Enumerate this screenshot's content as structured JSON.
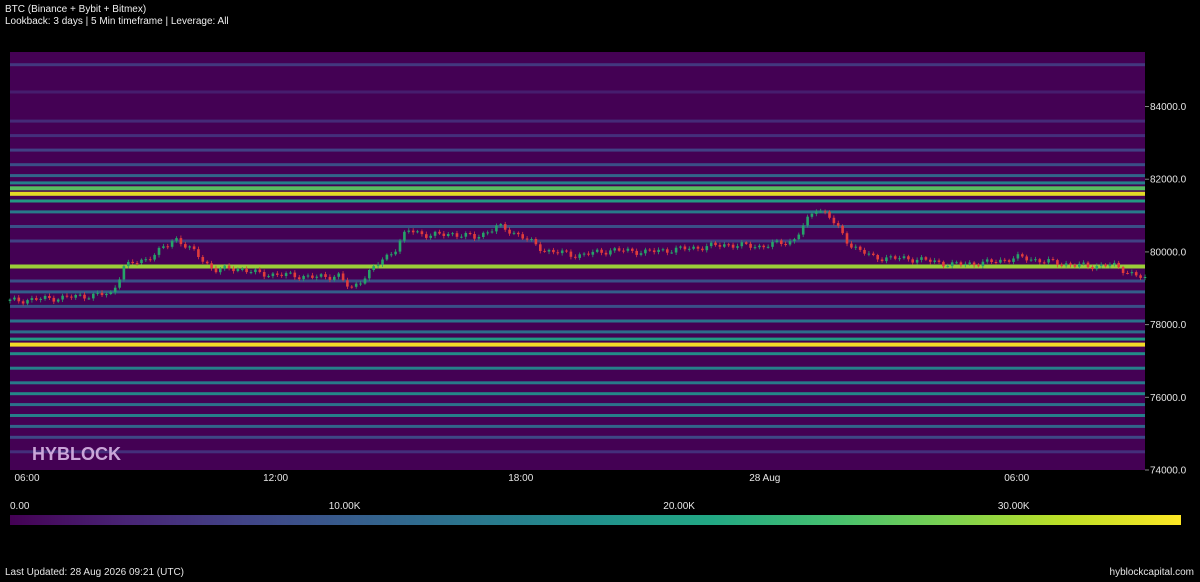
{
  "header": {
    "title": "BTC (Binance + Bybit + Bitmex)",
    "subtitle": "Lookback: 3 days | 5 Min timeframe | Leverage: All"
  },
  "watermark": "HYBLOCK",
  "footer": {
    "last_updated": "Last Updated: 28 Aug 2026 09:21 (UTC)",
    "site": "hyblockcapital.com"
  },
  "colors": {
    "background": "#000000",
    "up_candle": "#26a269",
    "down_candle": "#e03c3c",
    "viridis": [
      "#440154",
      "#482475",
      "#414487",
      "#355f8d",
      "#2a788e",
      "#21918c",
      "#22a884",
      "#44bf70",
      "#7ad151",
      "#bddf26",
      "#fde725"
    ]
  },
  "chart_data": {
    "type": "heatmap",
    "series_type": "liquidation-heatmap-with-candles",
    "x_ticks": [
      "06:00",
      "12:00",
      "18:00",
      "28 Aug",
      "06:00"
    ],
    "y_ticks": [
      "84000.0",
      "82000.0",
      "80000.0",
      "78000.0",
      "76000.0",
      "74000.0"
    ],
    "ylim": [
      74000,
      85500
    ],
    "colorbar": {
      "ticks": [
        "0.00",
        "10.00K",
        "20.00K",
        "30.00K"
      ],
      "range": [
        0,
        35000
      ]
    },
    "levels": [
      {
        "price": 85150,
        "value": 6000
      },
      {
        "price": 84400,
        "value": 3000
      },
      {
        "price": 83600,
        "value": 4500
      },
      {
        "price": 83200,
        "value": 5000
      },
      {
        "price": 82800,
        "value": 7000
      },
      {
        "price": 82400,
        "value": 9000
      },
      {
        "price": 82100,
        "value": 12000
      },
      {
        "price": 81900,
        "value": 16000
      },
      {
        "price": 81750,
        "value": 26000
      },
      {
        "price": 81600,
        "value": 34000
      },
      {
        "price": 81400,
        "value": 20000
      },
      {
        "price": 81100,
        "value": 15000
      },
      {
        "price": 80700,
        "value": 9000
      },
      {
        "price": 80300,
        "value": 7000
      },
      {
        "price": 79600,
        "value": 30000
      },
      {
        "price": 79200,
        "value": 9000
      },
      {
        "price": 78900,
        "value": 11000
      },
      {
        "price": 78500,
        "value": 9000
      },
      {
        "price": 78100,
        "value": 14000
      },
      {
        "price": 77800,
        "value": 13000
      },
      {
        "price": 77600,
        "value": 20000
      },
      {
        "price": 77450,
        "value": 35000
      },
      {
        "price": 77200,
        "value": 18000
      },
      {
        "price": 76800,
        "value": 16000
      },
      {
        "price": 76400,
        "value": 15000
      },
      {
        "price": 76100,
        "value": 17000
      },
      {
        "price": 75800,
        "value": 14000
      },
      {
        "price": 75500,
        "value": 16000
      },
      {
        "price": 75200,
        "value": 12000
      },
      {
        "price": 74900,
        "value": 8000
      },
      {
        "price": 74500,
        "value": 5000
      }
    ],
    "price_path": [
      [
        0,
        78650
      ],
      [
        0.05,
        78750
      ],
      [
        0.09,
        78850
      ],
      [
        0.1,
        79600
      ],
      [
        0.12,
        79800
      ],
      [
        0.14,
        80200
      ],
      [
        0.145,
        80400
      ],
      [
        0.16,
        80050
      ],
      [
        0.18,
        79500
      ],
      [
        0.2,
        79550
      ],
      [
        0.22,
        79400
      ],
      [
        0.25,
        79350
      ],
      [
        0.27,
        79300
      ],
      [
        0.29,
        79350
      ],
      [
        0.3,
        78950
      ],
      [
        0.32,
        79550
      ],
      [
        0.34,
        80100
      ],
      [
        0.35,
        80600
      ],
      [
        0.37,
        80450
      ],
      [
        0.39,
        80500
      ],
      [
        0.41,
        80400
      ],
      [
        0.43,
        80700
      ],
      [
        0.45,
        80450
      ],
      [
        0.47,
        80050
      ],
      [
        0.5,
        79900
      ],
      [
        0.53,
        80050
      ],
      [
        0.56,
        80000
      ],
      [
        0.6,
        80100
      ],
      [
        0.63,
        80200
      ],
      [
        0.66,
        80150
      ],
      [
        0.69,
        80300
      ],
      [
        0.71,
        81200
      ],
      [
        0.72,
        81050
      ],
      [
        0.74,
        80200
      ],
      [
        0.76,
        79850
      ],
      [
        0.8,
        79800
      ],
      [
        0.83,
        79650
      ],
      [
        0.86,
        79700
      ],
      [
        0.89,
        79850
      ],
      [
        0.92,
        79700
      ],
      [
        0.95,
        79600
      ],
      [
        0.97,
        79650
      ],
      [
        1.0,
        79250
      ]
    ]
  }
}
